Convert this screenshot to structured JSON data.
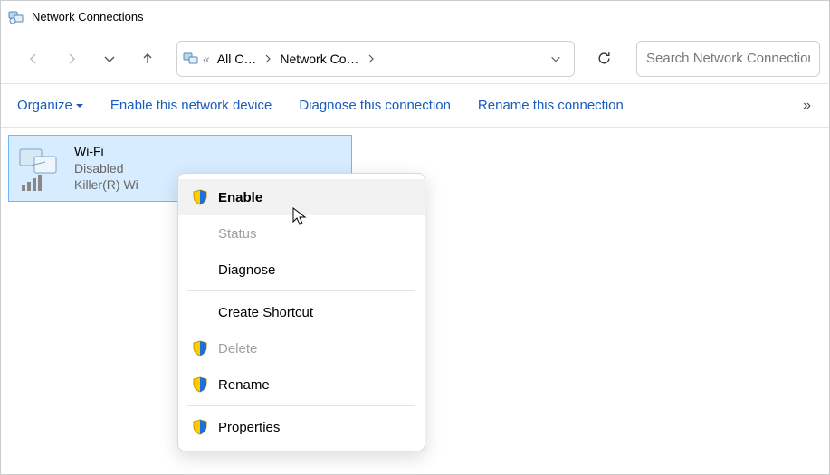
{
  "window": {
    "title": "Network Connections"
  },
  "breadcrumb": {
    "prefix": "«",
    "path1": "All C…",
    "path2": "Network Co…"
  },
  "search": {
    "placeholder": "Search Network Connections"
  },
  "commands": {
    "organize": "Organize",
    "enable_device": "Enable this network device",
    "diagnose": "Diagnose this connection",
    "rename": "Rename this connection",
    "overflow": "»"
  },
  "tile": {
    "name": "Wi-Fi",
    "status": "Disabled",
    "adapter": "Killer(R) Wi"
  },
  "context_menu": {
    "enable": "Enable",
    "status": "Status",
    "diagnose": "Diagnose",
    "create_shortcut": "Create Shortcut",
    "delete": "Delete",
    "rename": "Rename",
    "properties": "Properties"
  }
}
